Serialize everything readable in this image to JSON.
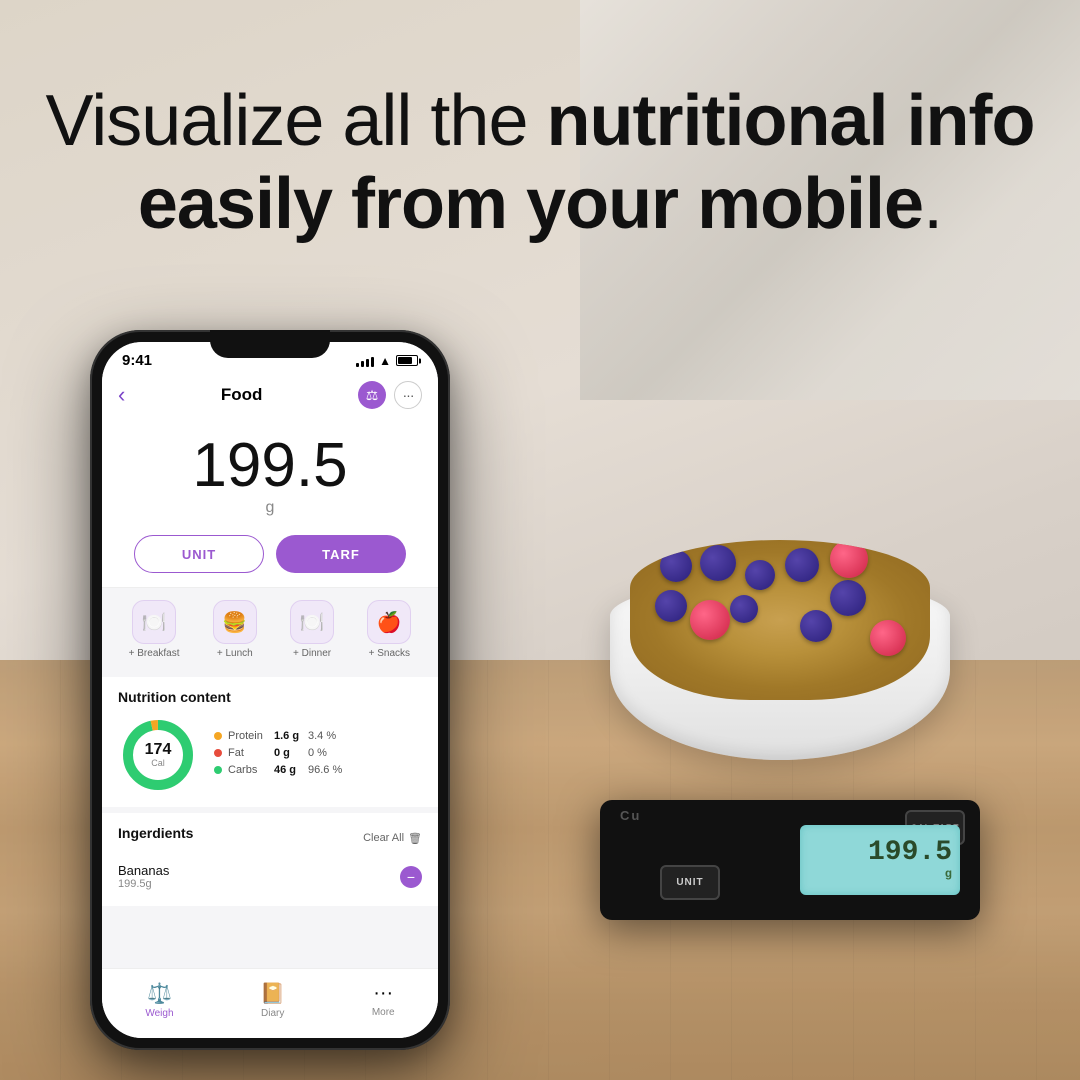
{
  "background": {
    "color": "#ddd5c8"
  },
  "headline": {
    "line1": "Visualize all the ",
    "line1_bold": "nutritional info",
    "line2_bold": "easily from your mobile",
    "line2_end": "."
  },
  "phone": {
    "status_time": "9:41",
    "app_title": "Food",
    "weight_value": "199.5",
    "weight_unit": "g",
    "unit_btn": "UNIT",
    "tare_btn": "TARF",
    "meals": [
      {
        "icon": "🍽️",
        "label": "+ Breakfast"
      },
      {
        "icon": "🍔",
        "label": "+ Lunch"
      },
      {
        "icon": "🍽️",
        "label": "+ Dinner"
      },
      {
        "icon": "🍎",
        "label": "+ Snacks"
      }
    ],
    "nutrition_title": "Nutrition content",
    "calories": "174",
    "calories_label": "Cal",
    "nutrients": [
      {
        "name": "Protein",
        "grams": "1.6 g",
        "pct": "3.4 %",
        "color": "#f5a623"
      },
      {
        "name": "Fat",
        "grams": "0 g",
        "pct": "0 %",
        "color": "#e74c3c"
      },
      {
        "name": "Carbs",
        "grams": "46 g",
        "pct": "96.6 %",
        "color": "#2ecc71"
      }
    ],
    "donut": {
      "segments": [
        {
          "label": "Protein",
          "pct": 3.4,
          "color": "#f5a623"
        },
        {
          "label": "Fat",
          "pct": 0,
          "color": "#e74c3c"
        },
        {
          "label": "Carbs",
          "pct": 96.6,
          "color": "#2ecc71"
        }
      ]
    },
    "ingredients_title": "Ingerdients",
    "clear_all": "Clear All",
    "ingredients": [
      {
        "name": "Bananas",
        "amount": "199.5g"
      }
    ],
    "nav": [
      {
        "label": "Weigh",
        "icon": "⚖️",
        "active": true
      },
      {
        "label": "Diary",
        "icon": "📔",
        "active": false
      },
      {
        "label": "More",
        "icon": "···",
        "active": false
      }
    ]
  },
  "scale": {
    "logo": "Cu",
    "display_weight": "199.5",
    "display_unit": "g",
    "btn_unit": "UNIT",
    "btn_tare": "CAL TARE"
  }
}
